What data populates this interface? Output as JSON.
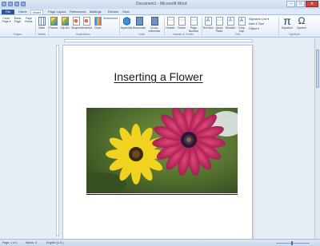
{
  "window": {
    "title": "Document1 - Microsoft Word"
  },
  "tabs": [
    "File",
    "Home",
    "Insert",
    "Page Layout",
    "References",
    "Mailings",
    "Review",
    "View"
  ],
  "ribbon": {
    "pages": {
      "cover_page": "Cover Page ▾",
      "blank_page": "Blank Page",
      "page_break": "Page Break",
      "group": "Pages"
    },
    "tables": {
      "table": "Table",
      "group": "Tables"
    },
    "illustrations": {
      "picture": "Picture",
      "clip_art": "Clip Art",
      "shapes": "Shapes",
      "smartart": "SmartArt",
      "chart": "Chart",
      "screenshot": "Screenshot",
      "group": "Illustrations"
    },
    "links": {
      "hyperlink": "Hyperlink",
      "bookmark": "Bookmark",
      "cross_reference": "Cross-reference",
      "group": "Links"
    },
    "header_footer": {
      "header": "Header",
      "footer": "Footer",
      "page_number": "Page Number",
      "group": "Header & Footer"
    },
    "text": {
      "text_box": "Text Box",
      "quick_parts": "Quick Parts",
      "wordart": "WordArt",
      "drop_cap": "Drop Cap",
      "signature_line": "Signature Line ▾",
      "date_time": "Date & Time",
      "object": "Object ▾",
      "group": "Text"
    },
    "symbols": {
      "equation": "Equation",
      "symbol": "Symbol",
      "group": "Symbols"
    }
  },
  "document": {
    "heading": "Inserting a Flower"
  },
  "status": {
    "page": "Page: 1 of 1",
    "words": "Words: 3",
    "language": "English (U.S.)"
  }
}
